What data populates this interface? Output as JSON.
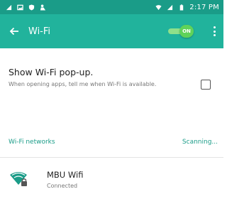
{
  "status_bar": {
    "time": "2:17 PM",
    "left_icons": [
      "signal-alert-icon",
      "image-icon",
      "shield-icon",
      "person-icon"
    ],
    "right_icons": [
      "wifi-status-icon",
      "cell-signal-icon",
      "battery-icon"
    ]
  },
  "app_bar": {
    "title": "Wi-Fi",
    "toggle_label": "ON",
    "toggle_on": true
  },
  "popup_setting": {
    "title": "Show Wi-Fi pop-up.",
    "description": "When opening apps, tell me when Wi-Fi is available.",
    "checked": false
  },
  "networks_section": {
    "header": "Wi-Fi networks",
    "status": "Scanning..."
  },
  "networks": [
    {
      "name": "MBU Wifi",
      "status": "Connected",
      "secured": true
    }
  ],
  "colors": {
    "status_bar": "#1a9c88",
    "app_bar": "#21b39c",
    "toggle": "#5fd35a",
    "accent_text": "#1a9c88"
  }
}
